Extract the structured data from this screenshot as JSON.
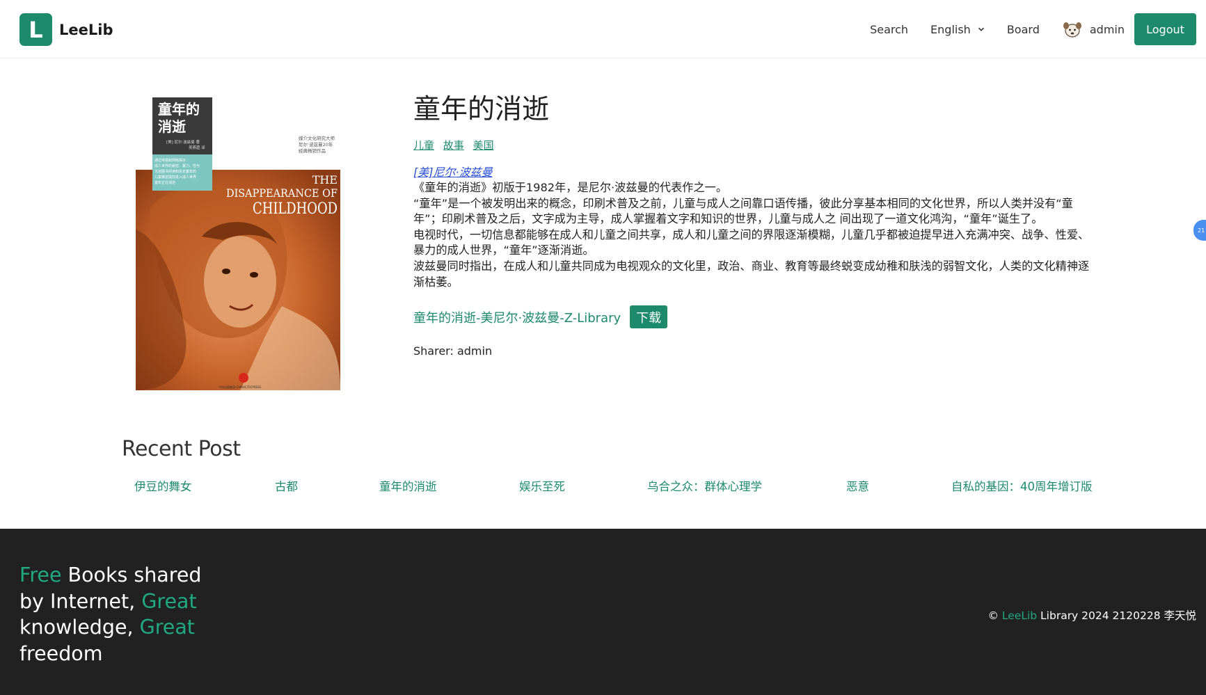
{
  "header": {
    "logo_letter": "L",
    "brand": "LeeLib",
    "nav": {
      "search": "Search",
      "language": "English",
      "board": "Board"
    },
    "user": "admin",
    "logout": "Logout"
  },
  "book": {
    "title": "童年的消逝",
    "tags": [
      "儿童",
      "故事",
      "美国"
    ],
    "author": "[美]尼尔·波兹曼",
    "description": [
      "《童年的消逝》初版于1982年，是尼尔·波兹曼的代表作之一。",
      "“童年”是一个被发明出来的概念，印刷术普及之前，儿童与成人之间靠口语传播，彼此分享基本相同的文化世界，所以人类并没有“童年”；印刷术普及之后，文字成为主导，成人掌握着文字和知识的世界，儿童与成人之 间出现了一道文化鸿沟，“童年”诞生了。",
      "电视时代，一切信息都能够在成人和儿童之间共享，成人和儿童之间的界限逐渐模糊，儿童几乎都被迫提早进入充满冲突、战争、性爱、暴力的成人世界，“童年”逐渐消逝。",
      "波兹曼同时指出，在成人和儿童共同成为电视观众的文化里，政治、商业、教育等最终蜕变成幼稚和肤浅的弱智文化，人类的文化精神逐渐枯萎。"
    ],
    "file_name": "童年的消逝-美尼尔·波兹曼-Z-Library",
    "download_label": "下载",
    "sharer": "Sharer: admin",
    "cover": {
      "title_lines": [
        "童年的",
        "消逝"
      ],
      "author_line": "[美] 尼尔·波兹曼 著",
      "translator_line": "吴燕莛 译",
      "subtitle_lines": [
        "媒介文化研究大师",
        "尼尔·波兹曼20年",
        "经典畅销作品"
      ],
      "en_title_lines": [
        "THE",
        "DISAPPEARANCE OF",
        "CHILDHOOD"
      ],
      "blurb_lines": [
        "通过电视和网络揭示",
        "成人世界的秘密、暴力、性与",
        "沉迷图书阅读和失去童年的",
        "儿童被迫提前进入成人世界",
        "童年正在消逝"
      ],
      "publisher": "中信出版集团 CHINACITICPRESS"
    }
  },
  "recent": {
    "title": "Recent Post",
    "items": [
      "伊豆的舞女",
      "古都",
      "童年的消逝",
      "娱乐至死",
      "乌合之众：群体心理学",
      "恶意",
      "自私的基因：40周年增订版"
    ]
  },
  "footer": {
    "slogan": [
      {
        "text": "Free",
        "accent": true
      },
      {
        "text": " Books shared by Internet, ",
        "accent": false
      },
      {
        "text": "Great",
        "accent": true
      },
      {
        "text": " knowledge, ",
        "accent": false
      },
      {
        "text": "Great",
        "accent": true
      },
      {
        "text": " freedom",
        "accent": false
      }
    ],
    "copyright_prefix": "© ",
    "copyright_brand": "LeeLib",
    "copyright_suffix": " Library 2024 2120228 李天悦"
  },
  "side_badge": "21",
  "colors": {
    "accent": "#1d8a6c",
    "footer_bg": "#212121",
    "author_link": "#2a4fd8"
  }
}
